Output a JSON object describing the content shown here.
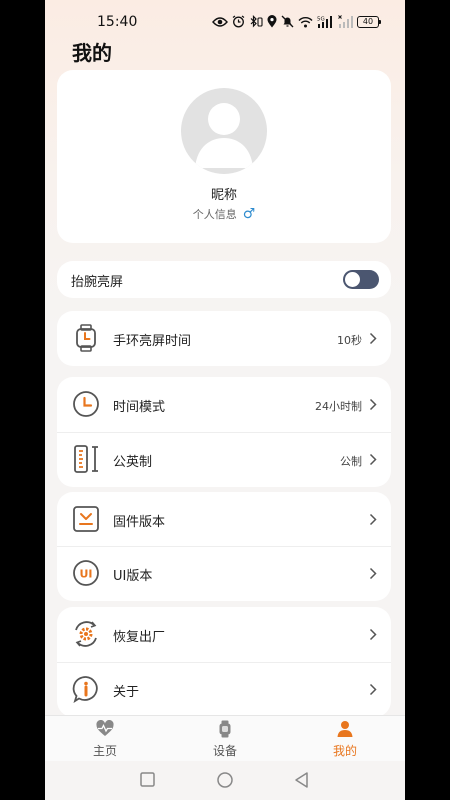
{
  "status_bar": {
    "time": "15:40",
    "battery": "40",
    "icons": [
      "eye-icon",
      "alarm-icon",
      "bluetooth-icon",
      "location-icon",
      "mute-icon",
      "wifi-icon",
      "signal-5g-icon",
      "signal-icon"
    ]
  },
  "page": {
    "title": "我的"
  },
  "profile": {
    "nickname": "昵称",
    "info_label": "个人信息",
    "gender_symbol": "♂"
  },
  "raise_wrist": {
    "label": "抬腕亮屏",
    "enabled": false
  },
  "settings": {
    "screen_time": {
      "label": "手环亮屏时间",
      "value": "10秒"
    },
    "time_mode": {
      "label": "时间模式",
      "value": "24小时制"
    },
    "units": {
      "label": "公英制",
      "value": "公制"
    },
    "firmware": {
      "label": "固件版本"
    },
    "ui_version": {
      "label": "UI版本"
    },
    "factory_reset": {
      "label": "恢复出厂"
    },
    "about": {
      "label": "关于"
    }
  },
  "tabs": [
    {
      "label": "主页",
      "icon": "heart-pulse-icon",
      "active": false
    },
    {
      "label": "设备",
      "icon": "watch-icon",
      "active": false
    },
    {
      "label": "我的",
      "icon": "person-icon",
      "active": true
    }
  ],
  "colors": {
    "accent": "#e8761e",
    "toggle_off": "#4b5670",
    "gender": "#2f8ccf"
  }
}
